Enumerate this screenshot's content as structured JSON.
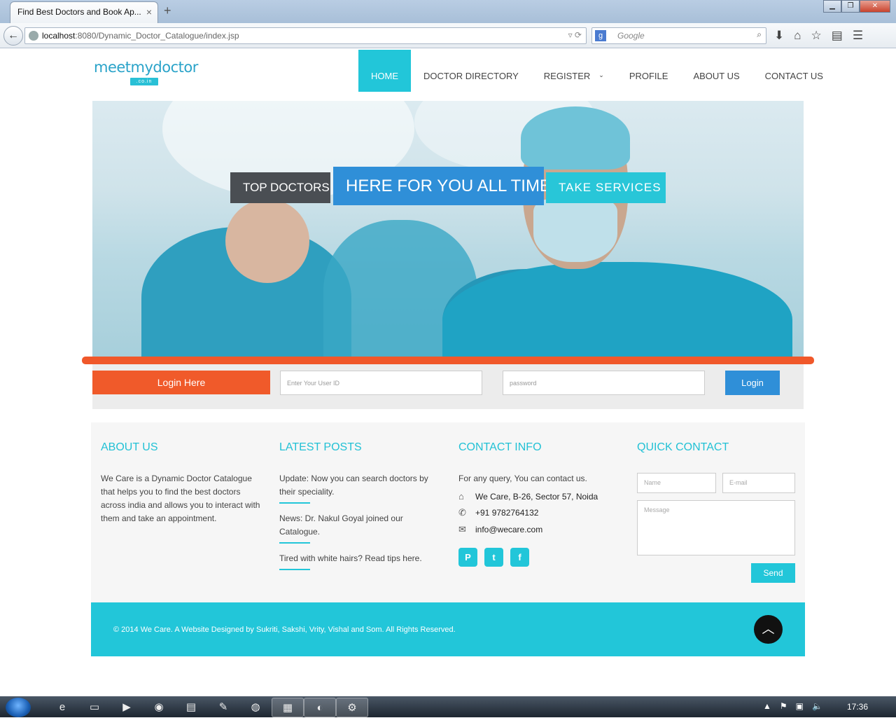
{
  "browser": {
    "tab_title": "Find Best Doctors and Book Ap...",
    "tab_close": "×",
    "new_tab": "+",
    "url_host": "localhost",
    "url_rest": ":8080/Dynamic_Doctor_Catalogue/index.jsp",
    "search_placeholder": "Google",
    "window_buttons": [
      "▁",
      "❐",
      "✕"
    ]
  },
  "site": {
    "logo_text": "meetmydoctor",
    "logo_tld": ".co.in",
    "nav": [
      {
        "label": "HOME",
        "active": true
      },
      {
        "label": "DOCTOR DIRECTORY"
      },
      {
        "label": "REGISTER",
        "has_dropdown": true
      },
      {
        "label": "PROFILE"
      },
      {
        "label": "ABOUT US"
      },
      {
        "label": "CONTACT US"
      }
    ],
    "hero": {
      "tag1": "TOP DOCTORS",
      "tag2": "HERE FOR YOU ALL TIME",
      "tag3": "TAKE SERVICES"
    },
    "login": {
      "label": "Login Here",
      "user_placeholder": "Enter Your User ID",
      "pass_placeholder": "password",
      "button": "Login"
    },
    "footer": {
      "about_title": "ABOUT US",
      "about_text": "We Care is a Dynamic Doctor Catalogue that helps you to find the best doctors across india and allows you to interact with them and take an appointment.",
      "posts_title": "LATEST POSTS",
      "posts": [
        "Update: Now you can search doctors by their speciality.",
        "News: Dr. Nakul Goyal joined our Catalogue.",
        "Tired with white hairs? Read tips here."
      ],
      "contact_title": "CONTACT INFO",
      "contact_intro": "For any query, You can contact us.",
      "address": "We Care, B-26, Sector 57, Noida",
      "phone": "+91 9782764132",
      "email": "info@wecare.com",
      "quick_title": "QUICK CONTACT",
      "qc_name": "Name",
      "qc_email": "E-mail",
      "qc_message": "Message",
      "qc_send": "Send",
      "copyright": "© 2014 We Care. A Website Designed by Sukriti, Sakshi, Vrity, Vishal and Som. All Rights Reserved."
    }
  },
  "taskbar": {
    "clock": "17:36"
  },
  "colors": {
    "accent": "#22c6d9",
    "blue": "#2f8fd8",
    "orange": "#f05a2a"
  }
}
